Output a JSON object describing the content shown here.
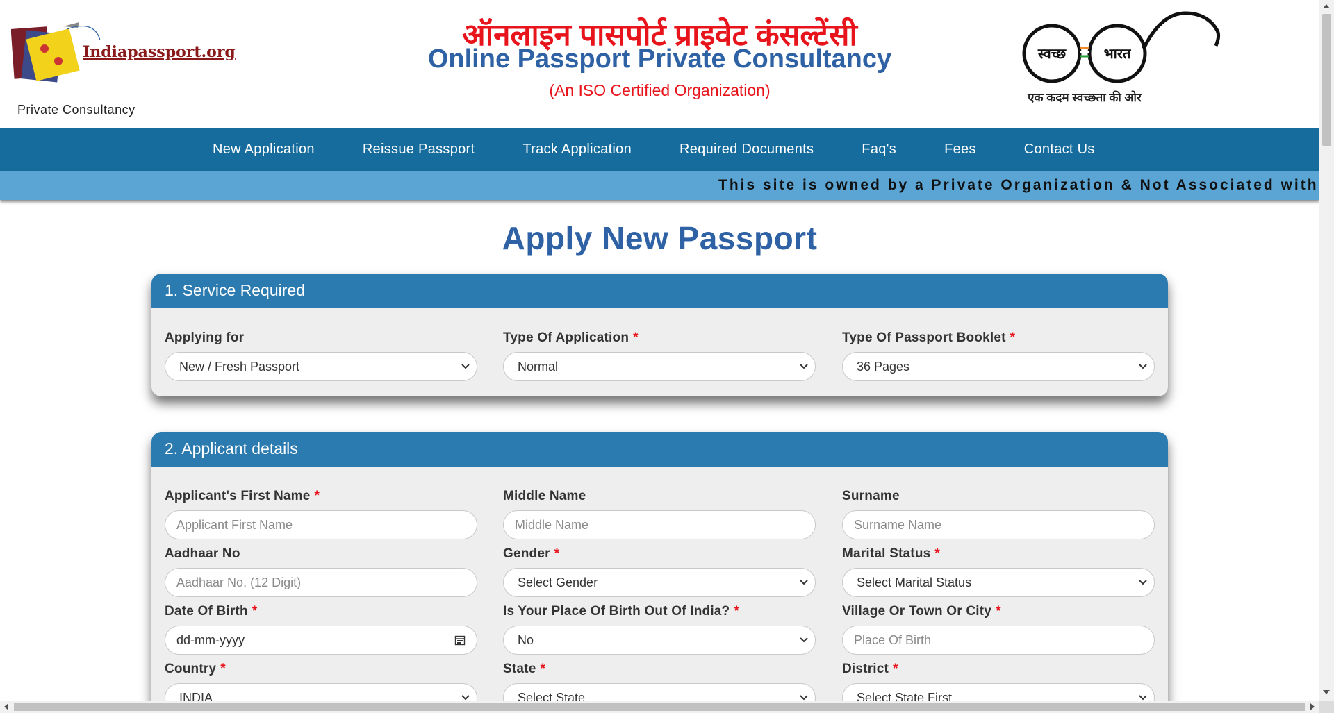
{
  "header": {
    "logo_text": "Indiapassport.org",
    "logo_sub": "Private Consultancy",
    "title_hindi": "ऑनलाइन पासपोर्ट प्राइवेट कंसल्टेंसी",
    "title_english": "Online Passport Private Consultancy",
    "title_iso": "(An ISO Certified Organization)",
    "swachh_left": "स्वच्छ",
    "swachh_right": "भारत",
    "swachh_tagline": "एक कदम स्वच्छता की ओर"
  },
  "nav": {
    "items": [
      "New Application",
      "Reissue Passport",
      "Track Application",
      "Required Documents",
      "Faq's",
      "Fees",
      "Contact Us"
    ]
  },
  "marquee": "This site is owned by a Private Organization & Not Associated with M",
  "page_title": "Apply New Passport",
  "section1": {
    "title": "1. Service Required",
    "applying_for": {
      "label": "Applying for",
      "value": "New / Fresh Passport"
    },
    "type_of_application": {
      "label": "Type Of Application",
      "value": "Normal"
    },
    "booklet": {
      "label": "Type Of Passport Booklet",
      "value": "36 Pages"
    }
  },
  "section2": {
    "title": "2. Applicant details",
    "first_name": {
      "label": "Applicant's First Name",
      "placeholder": "Applicant First Name"
    },
    "middle_name": {
      "label": "Middle Name",
      "placeholder": "Middle Name"
    },
    "surname": {
      "label": "Surname",
      "placeholder": "Surname Name"
    },
    "aadhaar": {
      "label": "Aadhaar No",
      "placeholder": "Aadhaar No. (12 Digit)"
    },
    "gender": {
      "label": "Gender",
      "value": "Select Gender"
    },
    "marital": {
      "label": "Marital Status",
      "value": "Select Marital Status"
    },
    "dob": {
      "label": "Date Of Birth",
      "value": "dd-mm-yyyy"
    },
    "birth_out_india": {
      "label": "Is Your Place Of Birth Out Of India?",
      "value": "No"
    },
    "village": {
      "label": "Village Or Town Or City",
      "placeholder": "Place Of Birth"
    },
    "country": {
      "label": "Country",
      "value": "INDIA"
    },
    "state": {
      "label": "State",
      "value": "Select State"
    },
    "district": {
      "label": "District",
      "value": "Select State First"
    }
  },
  "required_mark": "*",
  "colors": {
    "nav": "#156c9d",
    "marquee": "#5ba5d4",
    "card_head": "#2b7bb0",
    "title_blue": "#2f62a5",
    "red": "#e8141b"
  }
}
